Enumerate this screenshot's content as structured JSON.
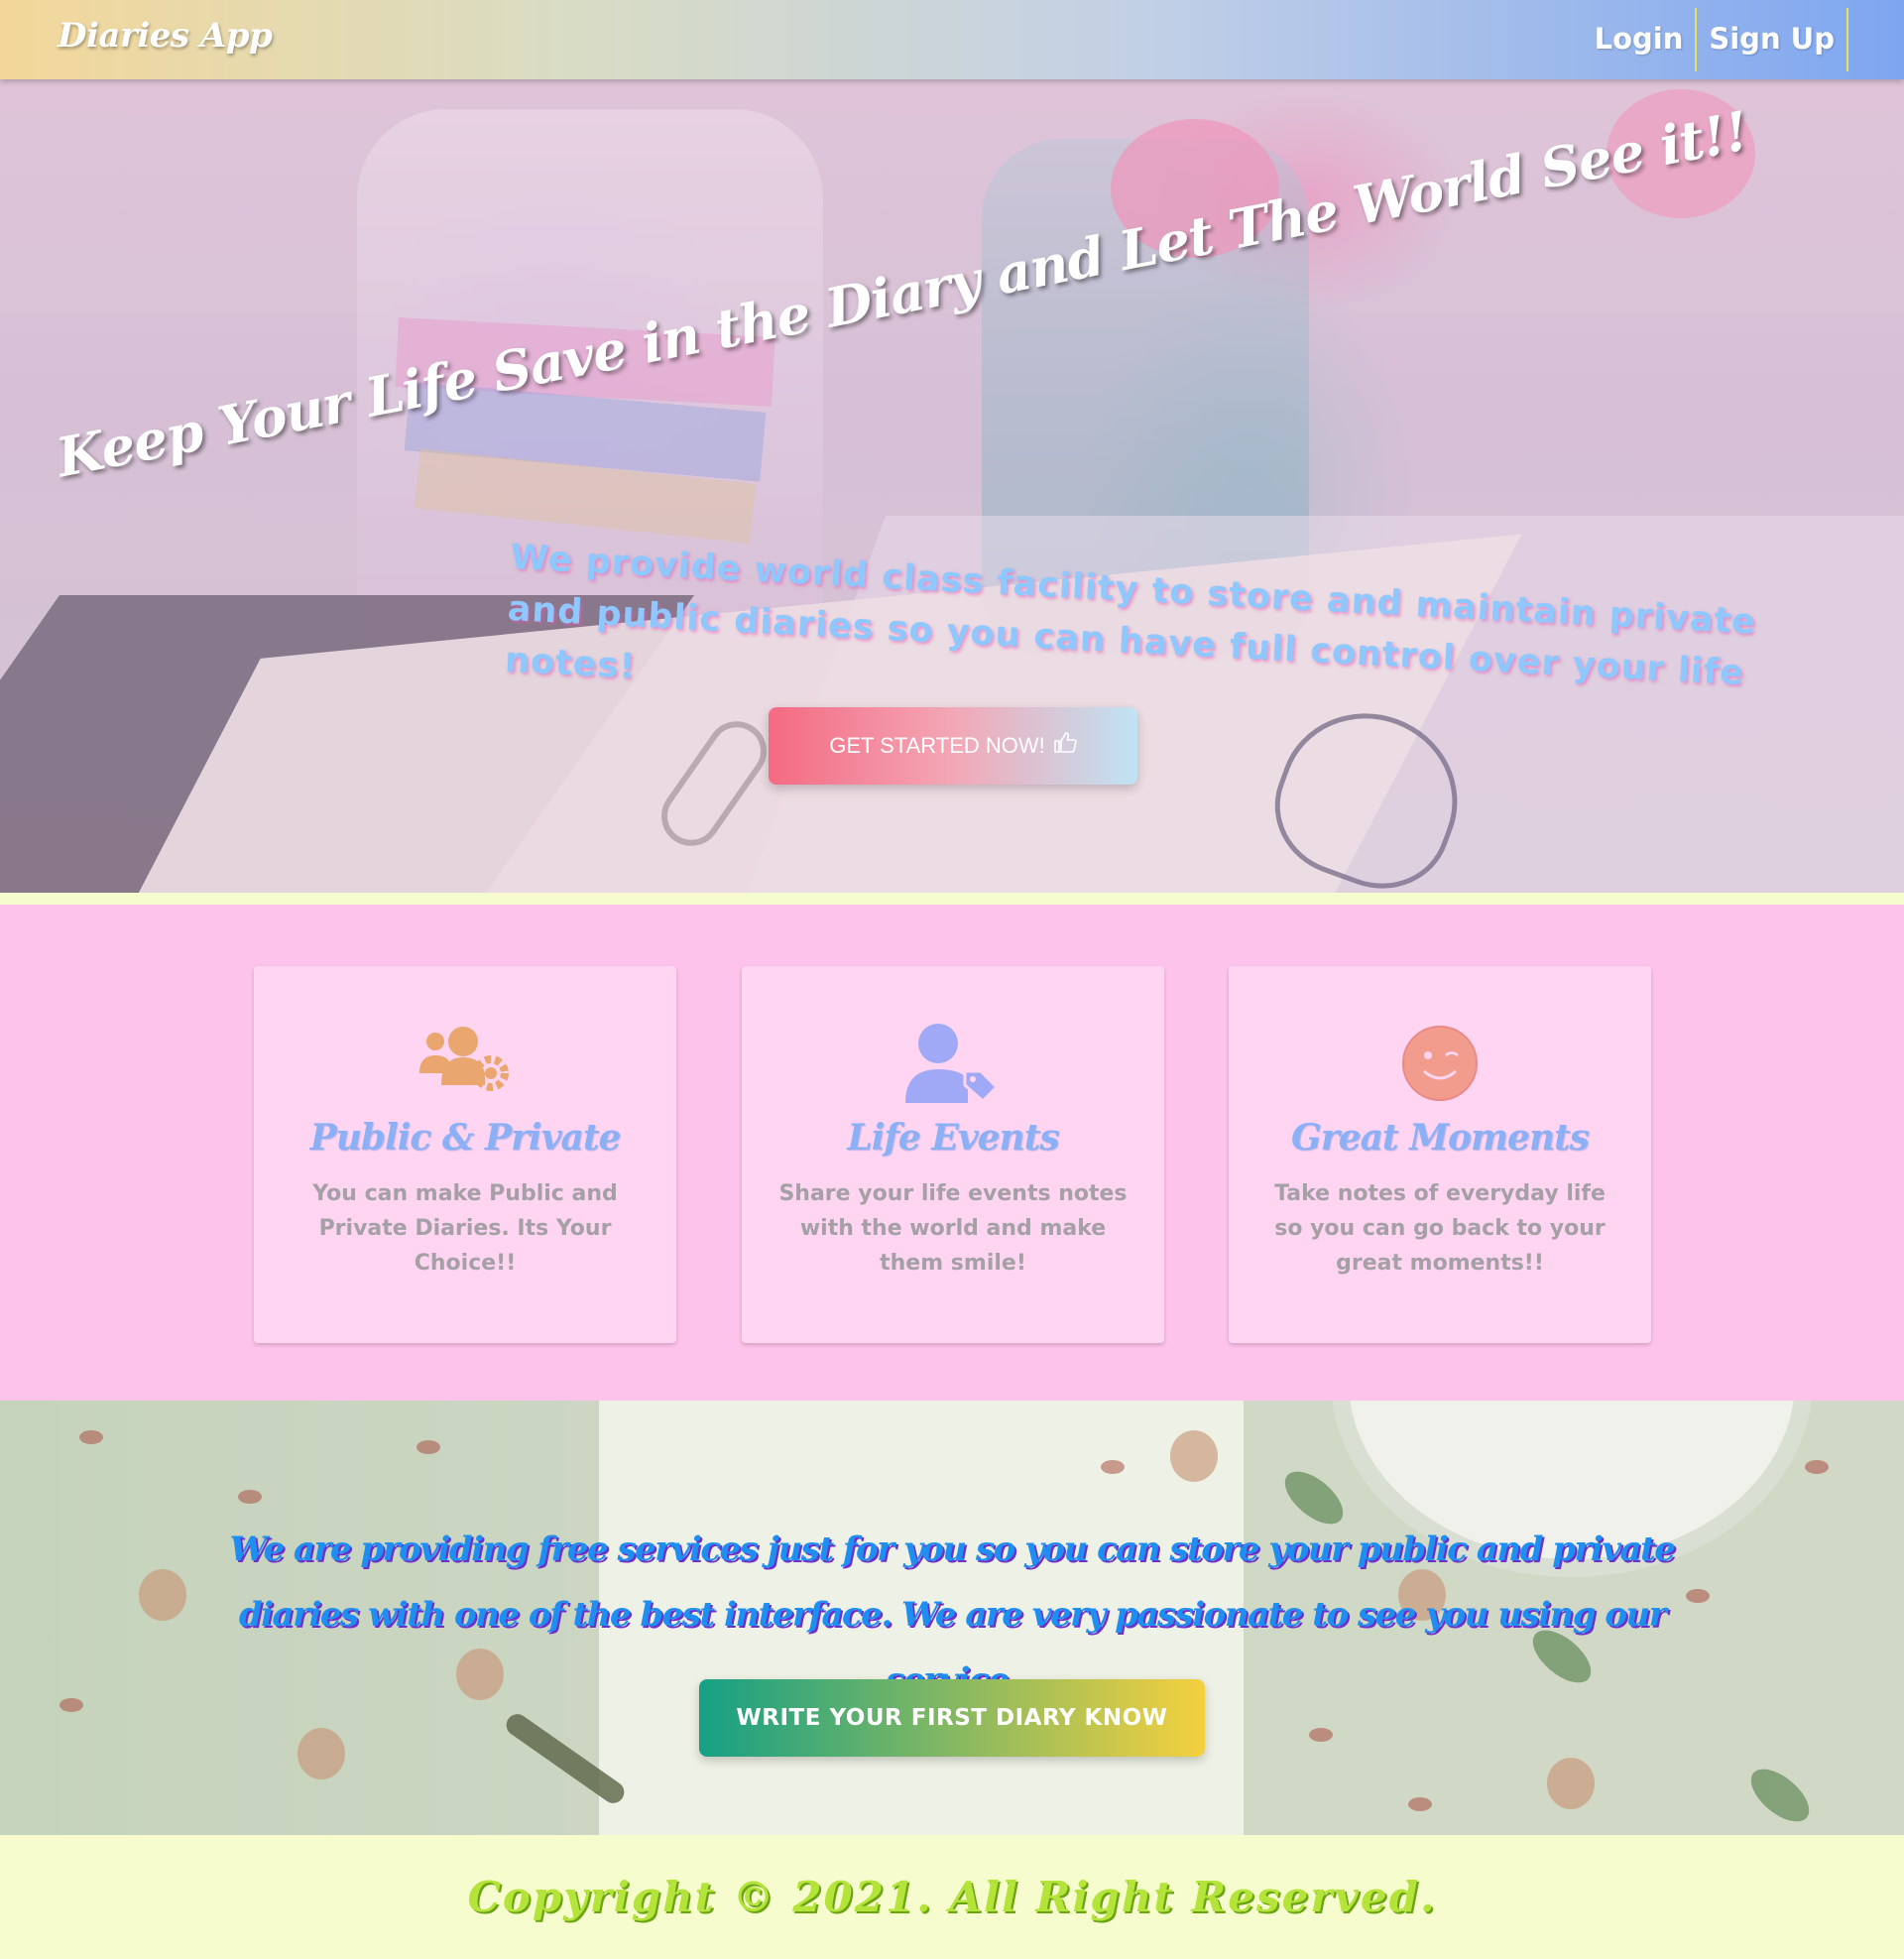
{
  "navbar": {
    "brand": "Diaries App",
    "links": [
      {
        "label": "Login"
      },
      {
        "label": "Sign Up"
      }
    ]
  },
  "hero": {
    "title": "Keep Your Life Save in the Diary and Let The World See it!!",
    "subtitle": "We provide world class facility to store and maintain private and public diaries so you can have full control over your life notes!",
    "cta_label": "GET STARTED NOW!",
    "cta_icon": "thumbs-up-icon"
  },
  "features": {
    "cards": [
      {
        "icon": "users-cog-icon",
        "title": "Public & Private",
        "text": "You can make Public and Private Diaries. Its Your Choice!!"
      },
      {
        "icon": "user-tag-icon",
        "title": "Life Events",
        "text": "Share your life events notes with the world and make them smile!"
      },
      {
        "icon": "wink-smile-icon",
        "title": "Great Moments",
        "text": "Take notes of everyday life so you can go back to your great moments!!"
      }
    ],
    "colors": {
      "section_bg": "#fec3eb",
      "card_bg": "#ffd5f2",
      "title": "#8bb0f5",
      "icon_users": "#e9a66f",
      "icon_user_tag": "#9fa9f5",
      "icon_smile": "#f19c8c"
    }
  },
  "service": {
    "text": "We are providing free services just for you so you can store your public and private diaries with one of the best interface. We are very passionate to see you using our service.",
    "cta_label": "WRITE YOUR FIRST DIARY KNOW"
  },
  "footer": {
    "text": "Copyright © 2021. All Right Reserved."
  }
}
